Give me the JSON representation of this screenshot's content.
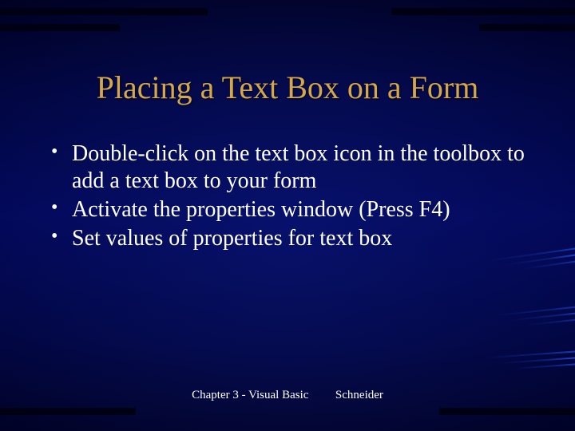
{
  "title": "Placing a Text Box on a Form",
  "bullets": [
    "Double-click on the text box icon in the toolbox to add a text box to your form",
    "Activate the properties window (Press F4)",
    "Set values of properties for text box"
  ],
  "footer": {
    "left": "Chapter 3 - Visual Basic",
    "right": "Schneider"
  }
}
